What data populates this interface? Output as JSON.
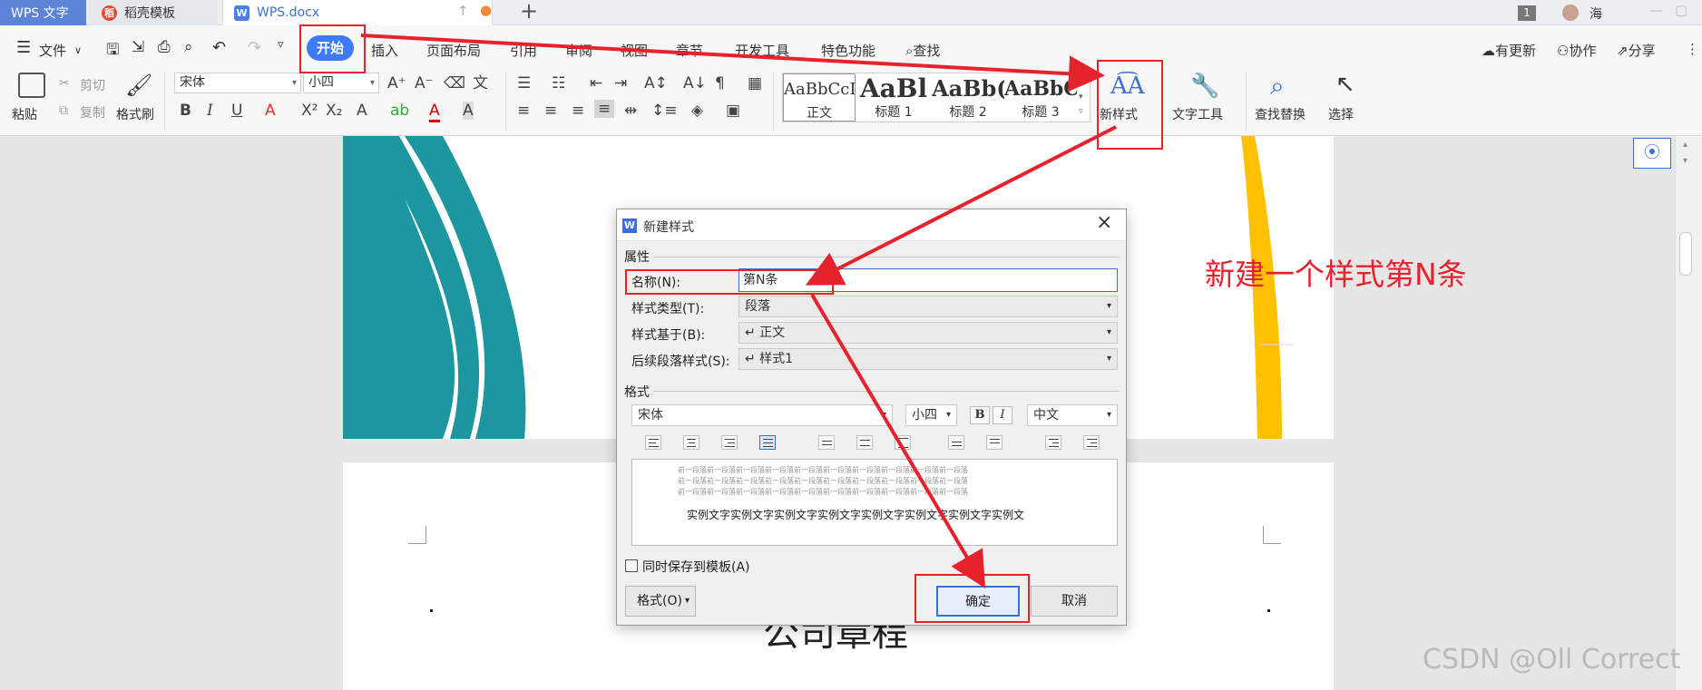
{
  "tabs": {
    "app": "WPS 文字",
    "daoke": "稻壳模板",
    "doc": "WPS.docx",
    "new_tab": "+",
    "page_badge": "1",
    "user": "海"
  },
  "menu": {
    "file": "文件",
    "start": "开始",
    "insert": "插入",
    "layout": "页面布局",
    "reference": "引用",
    "review": "审阅",
    "view": "视图",
    "section": "章节",
    "dev": "开发工具",
    "special": "特色功能",
    "search": "查找",
    "update": "有更新",
    "collab": "协作",
    "share": "分享"
  },
  "ribbon": {
    "paste": "粘贴",
    "cut": "剪切",
    "copy": "复制",
    "format_painter": "格式刷",
    "font_name": "宋体",
    "font_size": "小四",
    "new_style": "新样式",
    "text_tools": "文字工具",
    "find_replace": "查找替换",
    "select": "选择",
    "styles": [
      {
        "preview": "AaBbCcDd",
        "label": "正文"
      },
      {
        "preview": "AaBl",
        "label": "标题 1"
      },
      {
        "preview": "AaBb(",
        "label": "标题 2"
      },
      {
        "preview": "AaBbC",
        "label": "标题 3"
      }
    ]
  },
  "dialog": {
    "title": "新建样式",
    "section_props": "属性",
    "name_label": "名称(N):",
    "name_value": "第N条",
    "type_label": "样式类型(T):",
    "type_value": "段落",
    "based_label": "样式基于(B):",
    "based_value": "↵ 正文",
    "next_label": "后续段落样式(S):",
    "next_value": "↵ 样式1",
    "section_format": "格式",
    "font": "宋体",
    "size": "小四",
    "bold": "B",
    "italic": "I",
    "lang": "中文",
    "preview_prev": "前一段落前一段落前一段落前一段落前一段落前一段落前一段落前一段落前一段落前一段落",
    "preview_sample": "实例文字实例文字实例文字实例文字实例文字实例文字实例文字实例文",
    "save_template": "同时保存到模板(A)",
    "format_btn": "格式(O)",
    "ok": "确定",
    "cancel": "取消"
  },
  "document": {
    "heading_fragment": "公司章程"
  },
  "annotation": "新建一个样式第N条",
  "watermark": "CSDN @Oll Correct",
  "colors": {
    "accent_blue": "#3e7bfa",
    "teal": "#1e96a0",
    "yellow": "#ffc000",
    "annotation_red": "#e8222c"
  }
}
